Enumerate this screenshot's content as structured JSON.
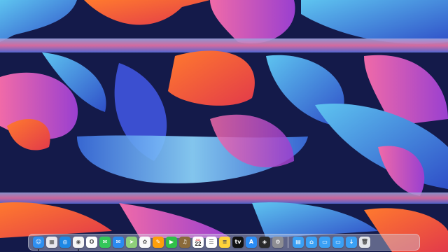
{
  "desktop": {
    "wallpaper": "abstract ribbons",
    "colors": {
      "background": "#141a4a",
      "ribbon_orange": "#f0562a",
      "ribbon_pink": "#e0478f",
      "ribbon_blue": "#3b6fe0",
      "ribbon_cyan": "#5ec4f0",
      "ribbon_violet": "#8c4fd0"
    }
  },
  "dock": {
    "apps": [
      {
        "name": "Finder",
        "icon": "finder-icon",
        "color": "#2f8ff0",
        "glyph": "☺",
        "running": true
      },
      {
        "name": "Launchpad",
        "icon": "launchpad-icon",
        "color": "#e8e8ee",
        "glyph": "▦",
        "running": false
      },
      {
        "name": "Safari",
        "icon": "safari-icon",
        "color": "#1e88e5",
        "glyph": "◎",
        "running": false
      },
      {
        "name": "Chrome",
        "icon": "chrome-icon",
        "color": "#f5f5f5",
        "glyph": "◉",
        "running": true
      },
      {
        "name": "Opera",
        "icon": "opera-icon",
        "color": "#ffffff",
        "glyph": "O",
        "running": false
      },
      {
        "name": "Messages",
        "icon": "messages-icon",
        "color": "#34c759",
        "glyph": "✉",
        "running": false
      },
      {
        "name": "Mail",
        "icon": "mail-icon",
        "color": "#2a8af0",
        "glyph": "✉",
        "running": false
      },
      {
        "name": "Maps",
        "icon": "maps-icon",
        "color": "#8ed07a",
        "glyph": "➤",
        "running": false
      },
      {
        "name": "Photos",
        "icon": "photos-icon",
        "color": "#fafafa",
        "glyph": "✿",
        "running": false
      },
      {
        "name": "Pages",
        "icon": "pages-icon",
        "color": "#ff9f0a",
        "glyph": "✎",
        "running": false
      },
      {
        "name": "FaceTime",
        "icon": "facetime-icon",
        "color": "#30c048",
        "glyph": "▶",
        "running": false
      },
      {
        "name": "Keynote",
        "icon": "keynote-icon",
        "color": "#8a6a3a",
        "glyph": "♫",
        "running": false
      },
      {
        "name": "Calendar",
        "icon": "calendar-icon",
        "color": "#ffffff",
        "month": "JUL",
        "day": "22",
        "running": false
      },
      {
        "name": "Reminders",
        "icon": "reminders-icon",
        "color": "#ffffff",
        "glyph": "☰",
        "running": false
      },
      {
        "name": "Notes",
        "icon": "notes-icon",
        "color": "#ffd43b",
        "glyph": "≡",
        "running": false
      },
      {
        "name": "TV",
        "icon": "tv-icon",
        "color": "#111111",
        "glyph": "tv",
        "running": false
      },
      {
        "name": "App Store",
        "icon": "app-store-icon",
        "color": "#2b8cf5",
        "glyph": "A",
        "running": false
      },
      {
        "name": "Activity Monitor",
        "icon": "activity-monitor-icon",
        "color": "#2a2a2a",
        "glyph": "◈",
        "running": false
      },
      {
        "name": "System Preferences",
        "icon": "system-preferences-icon",
        "color": "#8e8e93",
        "glyph": "⚙",
        "running": false
      }
    ],
    "folders": [
      {
        "name": "Applications",
        "icon": "applications-folder-icon",
        "color": "#3aa0f5",
        "glyph": "▤"
      },
      {
        "name": "Home",
        "icon": "home-folder-icon",
        "color": "#3aa0f5",
        "glyph": "⌂"
      },
      {
        "name": "Documents",
        "icon": "documents-folder-icon",
        "color": "#3aa0f5",
        "glyph": "▭"
      },
      {
        "name": "Desktop",
        "icon": "desktop-folder-icon",
        "color": "#3aa0f5",
        "glyph": "▭"
      },
      {
        "name": "Downloads",
        "icon": "downloads-folder-icon",
        "color": "#3aa0f5",
        "glyph": "↓"
      }
    ],
    "trash": {
      "name": "Trash",
      "icon": "trash-icon",
      "color": "#e3e5ea",
      "glyph": "🗑"
    }
  }
}
